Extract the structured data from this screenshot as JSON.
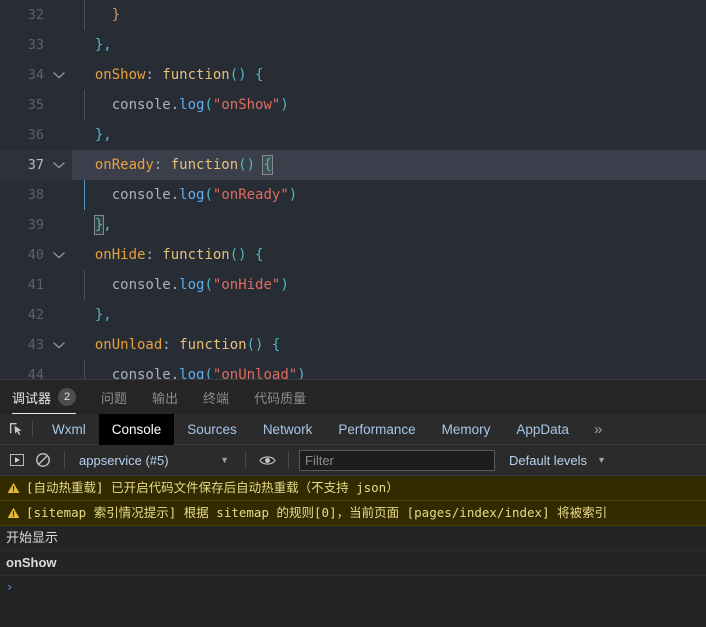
{
  "editor": {
    "lines": [
      {
        "no": "32",
        "fold": "",
        "indent": 2,
        "guide": true,
        "tokens": [
          {
            "t": "}",
            "c": "tk-yellow"
          }
        ]
      },
      {
        "no": "33",
        "fold": "",
        "indent": 1,
        "guide": false,
        "tokens": [
          {
            "t": "},",
            "c": "tk-brace"
          }
        ]
      },
      {
        "no": "34",
        "fold": "chevron-down",
        "indent": 1,
        "guide": false,
        "tokens": [
          {
            "t": "onShow",
            "c": "tk-prop"
          },
          {
            "t": ": ",
            "c": "tk-punct"
          },
          {
            "t": "function",
            "c": "tk-fn"
          },
          {
            "t": "()",
            "c": "tk-paren"
          },
          {
            "t": " {",
            "c": "tk-brace"
          }
        ]
      },
      {
        "no": "35",
        "fold": "",
        "indent": 2,
        "guide": true,
        "tokens": [
          {
            "t": "console",
            "c": "tk-plain"
          },
          {
            "t": ".",
            "c": "tk-punct"
          },
          {
            "t": "log",
            "c": "tk-method"
          },
          {
            "t": "(",
            "c": "tk-paren"
          },
          {
            "t": "\"onShow\"",
            "c": "tk-str"
          },
          {
            "t": ")",
            "c": "tk-paren"
          }
        ]
      },
      {
        "no": "36",
        "fold": "",
        "indent": 1,
        "guide": false,
        "tokens": [
          {
            "t": "},",
            "c": "tk-brace"
          }
        ]
      },
      {
        "no": "37",
        "fold": "chevron-down",
        "indent": 1,
        "guide": false,
        "active": true,
        "tokens": [
          {
            "t": "onReady",
            "c": "tk-prop"
          },
          {
            "t": ": ",
            "c": "tk-punct"
          },
          {
            "t": "function",
            "c": "tk-fn"
          },
          {
            "t": "()",
            "c": "tk-paren"
          },
          {
            "t": " ",
            "c": "tk-punct"
          },
          {
            "t": "{",
            "c": "tk-brace",
            "box": true
          }
        ]
      },
      {
        "no": "38",
        "fold": "",
        "indent": 2,
        "guide": true,
        "guideActive": true,
        "tokens": [
          {
            "t": "console",
            "c": "tk-plain"
          },
          {
            "t": ".",
            "c": "tk-punct"
          },
          {
            "t": "log",
            "c": "tk-method"
          },
          {
            "t": "(",
            "c": "tk-paren"
          },
          {
            "t": "\"onReady\"",
            "c": "tk-str"
          },
          {
            "t": ")",
            "c": "tk-paren"
          }
        ]
      },
      {
        "no": "39",
        "fold": "",
        "indent": 1,
        "guide": false,
        "tokens": [
          {
            "t": "}",
            "c": "tk-brace",
            "box": true
          },
          {
            "t": ",",
            "c": "tk-brace"
          }
        ]
      },
      {
        "no": "40",
        "fold": "chevron-down",
        "indent": 1,
        "guide": false,
        "tokens": [
          {
            "t": "onHide",
            "c": "tk-prop"
          },
          {
            "t": ": ",
            "c": "tk-punct"
          },
          {
            "t": "function",
            "c": "tk-fn"
          },
          {
            "t": "()",
            "c": "tk-paren"
          },
          {
            "t": " {",
            "c": "tk-brace"
          }
        ]
      },
      {
        "no": "41",
        "fold": "",
        "indent": 2,
        "guide": true,
        "tokens": [
          {
            "t": "console",
            "c": "tk-plain"
          },
          {
            "t": ".",
            "c": "tk-punct"
          },
          {
            "t": "log",
            "c": "tk-method"
          },
          {
            "t": "(",
            "c": "tk-paren"
          },
          {
            "t": "\"onHide\"",
            "c": "tk-str"
          },
          {
            "t": ")",
            "c": "tk-paren"
          }
        ]
      },
      {
        "no": "42",
        "fold": "",
        "indent": 1,
        "guide": false,
        "tokens": [
          {
            "t": "},",
            "c": "tk-brace"
          }
        ]
      },
      {
        "no": "43",
        "fold": "chevron-down",
        "indent": 1,
        "guide": false,
        "tokens": [
          {
            "t": "onUnload",
            "c": "tk-prop"
          },
          {
            "t": ": ",
            "c": "tk-punct"
          },
          {
            "t": "function",
            "c": "tk-fn"
          },
          {
            "t": "()",
            "c": "tk-paren"
          },
          {
            "t": " {",
            "c": "tk-brace"
          }
        ]
      },
      {
        "no": "44",
        "fold": "",
        "indent": 2,
        "guide": true,
        "tokens": [
          {
            "t": "console",
            "c": "tk-plain"
          },
          {
            "t": ".",
            "c": "tk-punct"
          },
          {
            "t": "log",
            "c": "tk-method"
          },
          {
            "t": "(",
            "c": "tk-paren"
          },
          {
            "t": "\"onUnload\"",
            "c": "tk-str"
          },
          {
            "t": ")",
            "c": "tk-paren"
          }
        ]
      }
    ]
  },
  "panel_tabs": [
    {
      "label": "调试器",
      "badge": "2",
      "active": true
    },
    {
      "label": "问题",
      "badge": "",
      "active": false
    },
    {
      "label": "输出",
      "badge": "",
      "active": false
    },
    {
      "label": "终端",
      "badge": "",
      "active": false
    },
    {
      "label": "代码质量",
      "badge": "",
      "active": false
    }
  ],
  "devtools": {
    "inspect_icon": "inspect-cursor-icon",
    "tabs": [
      {
        "label": "Wxml",
        "active": false
      },
      {
        "label": "Console",
        "active": true
      },
      {
        "label": "Sources",
        "active": false
      },
      {
        "label": "Network",
        "active": false
      },
      {
        "label": "Performance",
        "active": false
      },
      {
        "label": "Memory",
        "active": false
      },
      {
        "label": "AppData",
        "active": false
      }
    ],
    "more_label": "»",
    "toolbar": {
      "execute_icon": "play-boxed-icon",
      "clear_icon": "clear-console-icon",
      "context_value": "appservice (#5)",
      "eye_icon": "eye-icon",
      "filter_placeholder": "Filter",
      "filter_value": "",
      "levels_label": "Default levels",
      "levels_caret": "▼"
    },
    "messages": [
      {
        "type": "warn",
        "icon": "warning-triangle-icon",
        "text": "[自动热重载] 已开启代码文件保存后自动热重载（不支持 json）"
      },
      {
        "type": "warn",
        "icon": "warning-triangle-icon",
        "text": "[sitemap 索引情况提示] 根据 sitemap 的规则[0]，当前页面 [pages/index/index] 将被索引"
      },
      {
        "type": "log",
        "bold": false,
        "text": "开始显示"
      },
      {
        "type": "log",
        "bold": true,
        "text": "onShow"
      }
    ],
    "prompt_caret": "›"
  },
  "colors": {
    "editor_bg": "#282c34",
    "active_line": "#3a3f4b",
    "warn_bg": "#332b00",
    "warn_text": "#e8d98a",
    "accent_blue": "#a8c7e8"
  }
}
